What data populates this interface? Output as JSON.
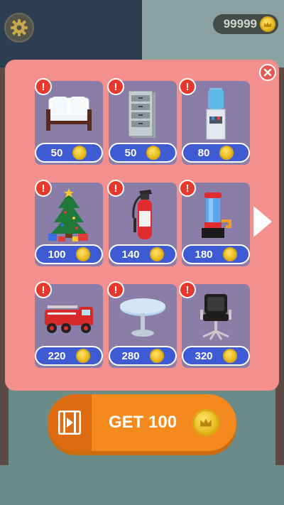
{
  "header": {
    "coin_balance": "99999",
    "settings_icon": "gear-icon",
    "coin_icon": "crown-coin-icon"
  },
  "shop": {
    "close_icon": "close-icon",
    "next_page_icon": "chevron-right-icon",
    "alert_mark": "!",
    "items": [
      {
        "name": "sofa",
        "price": "50"
      },
      {
        "name": "filing-cabinet",
        "price": "50"
      },
      {
        "name": "water-cooler",
        "price": "80"
      },
      {
        "name": "christmas-tree",
        "price": "100"
      },
      {
        "name": "fire-extinguisher",
        "price": "140"
      },
      {
        "name": "fire-alarm-device",
        "price": "180"
      },
      {
        "name": "fire-truck",
        "price": "220"
      },
      {
        "name": "round-table",
        "price": "280"
      },
      {
        "name": "office-chair",
        "price": "320"
      }
    ]
  },
  "reward_button": {
    "label": "GET 100",
    "video_icon": "video-film-icon"
  },
  "colors": {
    "panel": "#f3908e",
    "card": "#8a7ea8",
    "price_pill": "#3f5bd4",
    "alert": "#e8382c",
    "reward_button": "#f48a1e",
    "coin": "#f5c933"
  }
}
